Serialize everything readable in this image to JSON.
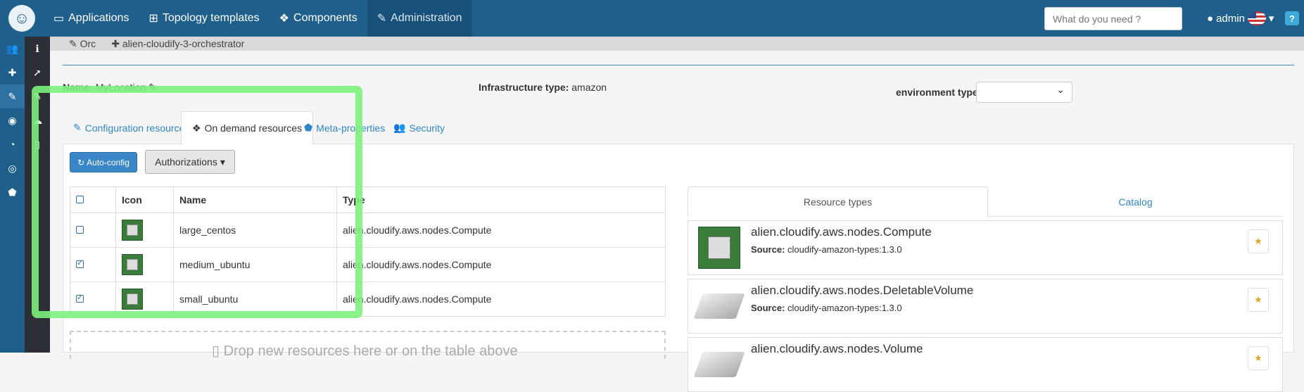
{
  "navbar": {
    "items": [
      {
        "icon": "desktop-icon",
        "label": "Applications"
      },
      {
        "icon": "sitemap-icon",
        "label": "Topology templates"
      },
      {
        "icon": "cubes-icon",
        "label": "Components"
      },
      {
        "icon": "wrench-icon",
        "label": "Administration"
      }
    ],
    "search_placeholder": "What do you need ?",
    "user": "admin",
    "help": "?"
  },
  "breadcrumb": {
    "items": [
      "Orc",
      "alien-cloudify-3-orchestrator"
    ]
  },
  "location": {
    "name_label": "Name:",
    "name": "MyLocation",
    "infra_label": "Infrastructure type:",
    "infra": "amazon",
    "env_label": "environment type:"
  },
  "tabs": [
    {
      "label": "Configuration resources"
    },
    {
      "label": "On demand resources"
    },
    {
      "label": "Meta-properties"
    },
    {
      "label": "Security"
    }
  ],
  "buttons": {
    "auto_config": "Auto-config",
    "authorizations": "Authorizations"
  },
  "table": {
    "headers": [
      "Icon",
      "Name",
      "Type"
    ],
    "rows": [
      {
        "name": "large_centos",
        "type": "alien.cloudify.aws.nodes.Compute",
        "checked": false
      },
      {
        "name": "medium_ubuntu",
        "type": "alien.cloudify.aws.nodes.Compute",
        "checked": true
      },
      {
        "name": "small_ubuntu",
        "type": "alien.cloudify.aws.nodes.Compute",
        "checked": true
      }
    ]
  },
  "dropzone": "Drop new resources here or on the table above",
  "right": {
    "tabs": [
      "Resource types",
      "Catalog"
    ],
    "source_label": "Source:",
    "items": [
      {
        "name": "alien.cloudify.aws.nodes.Compute",
        "source": "cloudify-amazon-types:1.3.0"
      },
      {
        "name": "alien.cloudify.aws.nodes.DeletableVolume",
        "source": "cloudify-amazon-types:1.3.0"
      },
      {
        "name": "alien.cloudify.aws.nodes.Volume",
        "source": ""
      }
    ]
  },
  "colors": {
    "navbar": "#1f5f8b",
    "highlight": "#7cf27c",
    "link": "#2f86c6"
  }
}
